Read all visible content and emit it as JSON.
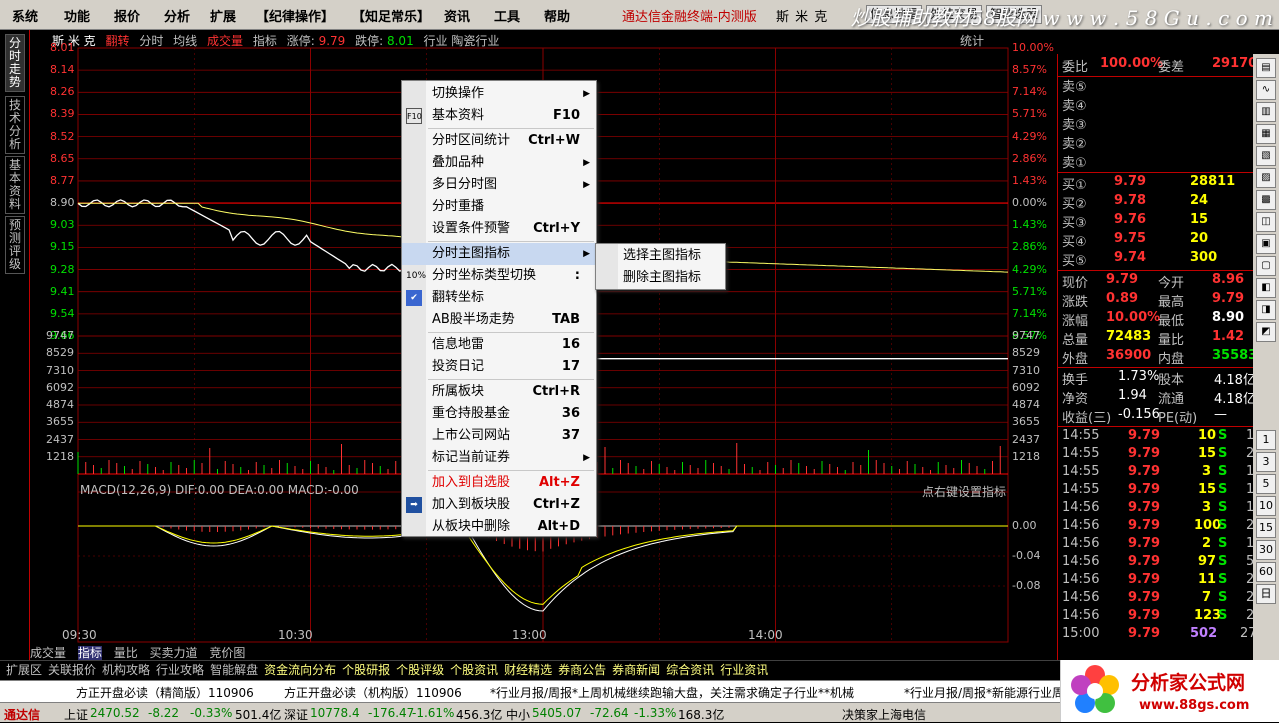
{
  "menubar": {
    "items": [
      "系统",
      "功能",
      "报价",
      "分析",
      "扩展",
      "【纪律操作】",
      "【知足常乐】",
      "资讯",
      "工具",
      "帮助"
    ],
    "app_title": "通达信金融终端-内测版",
    "stock_name": "斯 米 克",
    "buttons": [
      "信息地雷",
      "外挂交易",
      "智能选股"
    ],
    "logo_text": "炒股辅助教材58股网 w w w . 5 8 G u . c o m"
  },
  "left_tabs": [
    "分时走势",
    "技术分析",
    "基本资料",
    "预测评级"
  ],
  "chart_header": {
    "name": "斯 米 克",
    "tag": "翻转",
    "items": [
      "分时",
      "均线",
      "成交量",
      "指标"
    ],
    "limit_up_label": "涨停:",
    "limit_up": "9.79",
    "limit_down_label": "跌停:",
    "limit_down": "8.01",
    "industry": "行业 陶瓷行业",
    "stat": "统计"
  },
  "price_ticks_left": [
    "8.01",
    "8.14",
    "8.26",
    "8.39",
    "8.52",
    "8.65",
    "8.77",
    "8.90",
    "9.03",
    "9.15",
    "9.28",
    "9.41",
    "9.54",
    "9.66"
  ],
  "pct_ticks_right": [
    "10.00%",
    "8.57%",
    "7.14%",
    "5.71%",
    "4.29%",
    "2.86%",
    "1.43%",
    "0.00%",
    "1.43%",
    "2.86%",
    "4.29%",
    "5.71%",
    "7.14%",
    "8.57%"
  ],
  "vol_ticks": [
    "9747",
    "8529",
    "7310",
    "6092",
    "4874",
    "3655",
    "2437",
    "1218"
  ],
  "macd": {
    "title": "MACD(12,26,9)",
    "dif": "DIF:0.00",
    "dea": "DEA:0.00",
    "macd": "MACD:-0.00",
    "tip": "点右键设置指标",
    "ticks": [
      "0.00",
      "-0.04",
      "-0.08"
    ]
  },
  "time_ticks": [
    "09:30",
    "10:30",
    "13:00",
    "14:00"
  ],
  "bottom_tabs": [
    "成交量",
    "指标",
    "量比",
    "买卖力道",
    "竞价图"
  ],
  "context_menu": [
    {
      "label": "切换操作",
      "sc": "",
      "arrow": true
    },
    {
      "label": "基本资料",
      "sc": "F10",
      "icon": "F10"
    },
    {
      "label": "分时区间统计",
      "sc": "Ctrl+W",
      "sep": true
    },
    {
      "label": "叠加品种",
      "sc": "",
      "arrow": true
    },
    {
      "label": "多日分时图",
      "sc": "",
      "arrow": true
    },
    {
      "label": "分时重播",
      "sc": ""
    },
    {
      "label": "设置条件预警",
      "sc": "Ctrl+Y"
    },
    {
      "label": "分时主图指标",
      "sc": "",
      "arrow": true,
      "sep": true,
      "hl": true
    },
    {
      "label": "分时坐标类型切换",
      "sc": ":",
      "icon": "10%"
    },
    {
      "label": "翻转坐标",
      "sc": "",
      "icon": "✔"
    },
    {
      "label": "AB股半场走势",
      "sc": "TAB"
    },
    {
      "label": "信息地雷",
      "sc": "16",
      "sep": true
    },
    {
      "label": "投资日记",
      "sc": "17"
    },
    {
      "label": "所属板块",
      "sc": "Ctrl+R",
      "sep": true
    },
    {
      "label": "重仓持股基金",
      "sc": "36"
    },
    {
      "label": "上市公司网站",
      "sc": "37"
    },
    {
      "label": "标记当前证券",
      "sc": "",
      "arrow": true
    },
    {
      "label": "加入到自选股",
      "sc": "Alt+Z",
      "red": true,
      "sep": true
    },
    {
      "label": "加入到板块股",
      "sc": "Ctrl+Z",
      "icon": "➡"
    },
    {
      "label": "从板块中删除",
      "sc": "Alt+D"
    }
  ],
  "submenu": [
    "选择主图指标",
    "删除主图指标"
  ],
  "right_panel": {
    "weibi_label": "委比",
    "weibi": "100.00%",
    "weicha_label": "委差",
    "weicha": "29170",
    "sell": [
      "卖⑤",
      "卖④",
      "卖③",
      "卖②",
      "卖①"
    ],
    "buy": [
      {
        "l": "买①",
        "p": "9.79",
        "v": "28811"
      },
      {
        "l": "买②",
        "p": "9.78",
        "v": "24"
      },
      {
        "l": "买③",
        "p": "9.76",
        "v": "15"
      },
      {
        "l": "买④",
        "p": "9.75",
        "v": "20"
      },
      {
        "l": "买⑤",
        "p": "9.74",
        "v": "300"
      }
    ],
    "stats": [
      {
        "a": "现价",
        "av": "9.79",
        "b": "今开",
        "bv": "8.96"
      },
      {
        "a": "涨跌",
        "av": "0.89",
        "b": "最高",
        "bv": "9.79"
      },
      {
        "a": "涨幅",
        "av": "10.00%",
        "b": "最低",
        "bv": "8.90"
      },
      {
        "a": "总量",
        "av": "72483",
        "b": "量比",
        "bv": "1.42"
      },
      {
        "a": "外盘",
        "av": "36900",
        "b": "内盘",
        "bv": "35583"
      }
    ],
    "stats2": [
      {
        "a": "换手",
        "av": "1.73%",
        "b": "股本",
        "bv": "4.18亿"
      },
      {
        "a": "净资",
        "av": "1.94",
        "b": "流通",
        "bv": "4.18亿"
      },
      {
        "a": "收益(三)",
        "av": "-0.156",
        "b": "PE(动)",
        "bv": "—"
      }
    ],
    "trades": [
      {
        "t": "14:55",
        "p": "9.79",
        "v": "10",
        "s": "S",
        "n": "1"
      },
      {
        "t": "14:55",
        "p": "9.79",
        "v": "15",
        "s": "S",
        "n": "2"
      },
      {
        "t": "14:55",
        "p": "9.79",
        "v": "3",
        "s": "S",
        "n": "1"
      },
      {
        "t": "14:55",
        "p": "9.79",
        "v": "15",
        "s": "S",
        "n": "1"
      },
      {
        "t": "14:56",
        "p": "9.79",
        "v": "3",
        "s": "S",
        "n": "1"
      },
      {
        "t": "14:56",
        "p": "9.79",
        "v": "100",
        "s": "S",
        "n": "2"
      },
      {
        "t": "14:56",
        "p": "9.79",
        "v": "2",
        "s": "S",
        "n": "1"
      },
      {
        "t": "14:56",
        "p": "9.79",
        "v": "97",
        "s": "S",
        "n": "5"
      },
      {
        "t": "14:56",
        "p": "9.79",
        "v": "11",
        "s": "S",
        "n": "2"
      },
      {
        "t": "14:56",
        "p": "9.79",
        "v": "7",
        "s": "S",
        "n": "2"
      },
      {
        "t": "14:56",
        "p": "9.79",
        "v": "123",
        "s": "S",
        "n": "2"
      },
      {
        "t": "15:00",
        "p": "9.79",
        "v": "502",
        "s": "",
        "n": "27"
      }
    ]
  },
  "side_icons": [
    "1",
    "3",
    "5",
    "10",
    "15",
    "30",
    "60",
    "日"
  ],
  "taskbar": [
    "扩展区",
    "关联报价",
    "机构攻略",
    "行业攻略",
    "智能解盘",
    "资金流向分布",
    "个股研报",
    "个股评级",
    "个股资讯",
    "财经精选",
    "券商公告",
    "券商新闻",
    "综合资讯",
    "行业资讯"
  ],
  "ticker": [
    "方正开盘必读（精简版）110906",
    "方正开盘必读（机构版）110906",
    "*行业月报/周报*上周机械继续跑输大盘，关注需求确定子行业**机械",
    "*行业月报/周报*新能源行业周报"
  ],
  "status": {
    "brand": "通达信",
    "sh_label": "上证",
    "sh": "2470.52",
    "sh_chg": "-8.22",
    "sh_pct": "-0.33%",
    "sh_amt": "501.4亿",
    "sz_label": "深证",
    "sz": "10778.4",
    "sz_chg": "-176.47",
    "sz_pct": "-1.61%",
    "sz_amt": "456.3亿",
    "zx_label": "中小",
    "zx": "5405.07",
    "zx_chg": "-72.64",
    "zx_pct": "-1.33%",
    "zx_amt": "168.3亿",
    "broker": "决策家上海电信"
  },
  "bottom_logo": {
    "t1": "分析家公式网",
    "t2": "www.88gs.com"
  },
  "colors": {
    "red": "#ff3232",
    "green": "#00e000",
    "yellow": "#ffff00",
    "grid": "#8b0000"
  }
}
